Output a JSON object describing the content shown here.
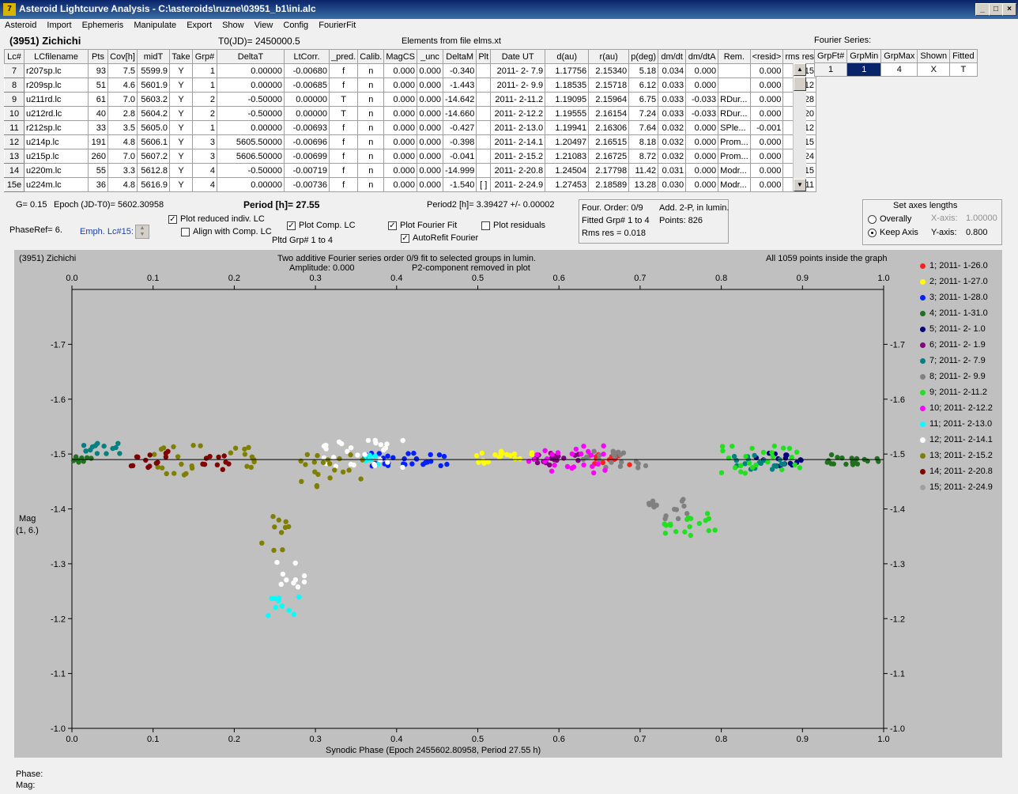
{
  "window": {
    "title": "Asteroid Lightcurve Analysis - C:\\asteroids\\ruzne\\03951_b1\\ini.alc",
    "icon": "7"
  },
  "menu": [
    "Asteroid",
    "Import",
    "Ephemeris",
    "Manipulate",
    "Export",
    "Show",
    "View",
    "Config",
    "FourierFit"
  ],
  "header": {
    "object": "(3951) Zichichi",
    "t0": "T0(JD)= 2450000.5",
    "elements": "Elements from file elms.xt",
    "fourier_label": "Fourier Series:"
  },
  "grid": {
    "columns": [
      "Lc#",
      "LCfilename",
      "Pts",
      "Cov[h]",
      "midT",
      "Take",
      "Grp#",
      "DeltaT",
      "LtCorr.",
      "_pred.",
      "Calib.",
      "MagCS",
      "_unc",
      "DeltaM",
      "Plt",
      "Date UT",
      "d(au)",
      "r(au)",
      "p(deg)",
      "dm/dt",
      "dm/dtA",
      "Rem.",
      "<resid>",
      "rms res"
    ],
    "rows": [
      [
        "7",
        "r207sp.lc",
        "93",
        "7.5",
        "5599.9",
        "Y",
        "1",
        "0.00000",
        "-0.00680",
        "f",
        "n",
        "0.000",
        "0.000",
        "-0.340",
        "",
        "2011- 2- 7.9",
        "1.17756",
        "2.15340",
        "5.18",
        "0.034",
        "0.000",
        "",
        "0.000",
        "0.015"
      ],
      [
        "8",
        "r209sp.lc",
        "51",
        "4.6",
        "5601.9",
        "Y",
        "1",
        "0.00000",
        "-0.00685",
        "f",
        "n",
        "0.000",
        "0.000",
        "-1.443",
        "",
        "2011- 2- 9.9",
        "1.18535",
        "2.15718",
        "6.12",
        "0.033",
        "0.000",
        "",
        "0.000",
        "0.012"
      ],
      [
        "9",
        "u211rd.lc",
        "61",
        "7.0",
        "5603.2",
        "Y",
        "2",
        "-0.50000",
        "0.00000",
        "T",
        "n",
        "0.000",
        "0.000",
        "-14.642",
        "",
        "2011- 2-11.2",
        "1.19095",
        "2.15964",
        "6.75",
        "0.033",
        "-0.033",
        "RDur...",
        "0.000",
        "0.028"
      ],
      [
        "10",
        "u212rd.lc",
        "40",
        "2.8",
        "5604.2",
        "Y",
        "2",
        "-0.50000",
        "0.00000",
        "T",
        "n",
        "0.000",
        "0.000",
        "-14.660",
        "",
        "2011- 2-12.2",
        "1.19555",
        "2.16154",
        "7.24",
        "0.033",
        "-0.033",
        "RDur...",
        "0.000",
        "0.020"
      ],
      [
        "11",
        "r212sp.lc",
        "33",
        "3.5",
        "5605.0",
        "Y",
        "1",
        "0.00000",
        "-0.00693",
        "f",
        "n",
        "0.000",
        "0.000",
        "-0.427",
        "",
        "2011- 2-13.0",
        "1.19941",
        "2.16306",
        "7.64",
        "0.032",
        "0.000",
        "SPle...",
        "-0.001",
        "0.012"
      ],
      [
        "12",
        "u214p.lc",
        "191",
        "4.8",
        "5606.1",
        "Y",
        "3",
        "5605.50000",
        "-0.00696",
        "f",
        "n",
        "0.000",
        "0.000",
        "-0.398",
        "",
        "2011- 2-14.1",
        "1.20497",
        "2.16515",
        "8.18",
        "0.032",
        "0.000",
        "Prom...",
        "0.000",
        "0.015"
      ],
      [
        "13",
        "u215p.lc",
        "260",
        "7.0",
        "5607.2",
        "Y",
        "3",
        "5606.50000",
        "-0.00699",
        "f",
        "n",
        "0.000",
        "0.000",
        "-0.041",
        "",
        "2011- 2-15.2",
        "1.21083",
        "2.16725",
        "8.72",
        "0.032",
        "0.000",
        "Prom...",
        "0.000",
        "0.024"
      ],
      [
        "14",
        "u220m.lc",
        "55",
        "3.3",
        "5612.8",
        "Y",
        "4",
        "-0.50000",
        "-0.00719",
        "f",
        "n",
        "0.000",
        "0.000",
        "-14.999",
        "",
        "2011- 2-20.8",
        "1.24504",
        "2.17798",
        "11.42",
        "0.031",
        "0.000",
        "Modr...",
        "0.000",
        "0.015"
      ],
      [
        "15e",
        "u224m.lc",
        "36",
        "4.8",
        "5616.9",
        "Y",
        "4",
        "0.00000",
        "-0.00736",
        "f",
        "n",
        "0.000",
        "0.000",
        "-1.540",
        "[ ]",
        "2011- 2-24.9",
        "1.27453",
        "2.18589",
        "13.28",
        "0.030",
        "0.000",
        "Modr...",
        "0.000",
        "0.011"
      ]
    ]
  },
  "fourier_table": {
    "columns": [
      "GrpFt#",
      "GrpMin",
      "GrpMax",
      "Shown",
      "Fitted"
    ],
    "row": [
      "1",
      "1",
      "4",
      "X",
      "T"
    ]
  },
  "info": {
    "g": "G= 0.15",
    "epoch": "Epoch (JD-T0)= 5602.30958",
    "period": "Period [h]= 27.55",
    "period2": "Period2 [h]= 3.39427 +/- 0.00002",
    "phaseref": "PhaseRef= 6.",
    "emph": "Emph. Lc#15:",
    "cb_reduced": "Plot reduced indiv. LC",
    "cb_align": "Align with Comp. LC",
    "cb_comp": "Plot Comp. LC",
    "pltd_grp": "Pltd Grp#  1    to    4",
    "cb_fourier": "Plot Fourier Fit",
    "cb_autorefit": "AutoRefit Fourier",
    "cb_residuals": "Plot residuals",
    "four_order": "Four. Order:  0/9",
    "add2p": "Add. 2-P, in lumin.",
    "fitted_grp": "Fitted Grp# 1 to 4",
    "points": "Points: 826",
    "rms": "Rms res     = 0.018"
  },
  "axes_box": {
    "title": "Set axes lengths",
    "overally": "Overally",
    "keep": "Keep Axis",
    "xaxis_label": "X-axis:",
    "xaxis_val": "1.00000",
    "yaxis_label": "Y-axis:",
    "yaxis_val": "0.800"
  },
  "plot": {
    "name": "(3951) Zichichi",
    "title1": "Two additive Fourier series order 0/9 fit to selected groups in lumin.",
    "title2a": "Amplitude: 0.000",
    "title2b": "P2-component removed in plot",
    "inside": "All 1059 points inside the graph",
    "ylabel1": "Mag",
    "ylabel2": "(1, 6.)",
    "xlabel": "Synodic Phase (Epoch 2455602.80958, Period 27.55 h)"
  },
  "chart_data": {
    "type": "scatter",
    "xlim": [
      0.0,
      1.0
    ],
    "ylim": [
      -1.0,
      -1.8
    ],
    "xticks": [
      "0.0",
      "0.1",
      "0.2",
      "0.3",
      "0.4",
      "0.5",
      "0.6",
      "0.7",
      "0.8",
      "0.9",
      "1.0"
    ],
    "yticks": [
      "-1.7",
      "-1.6",
      "-1.5",
      "-1.4",
      "-1.3",
      "-1.2",
      "-1.1",
      "-1.0"
    ],
    "fit_line_y": -1.49,
    "series": [
      {
        "name": "1; 2011- 1-26.0",
        "color": "#ff2020",
        "segments": [
          [
            0.64,
            0.69,
            -1.49,
            0.01
          ]
        ]
      },
      {
        "name": "2; 2011- 1-27.0",
        "color": "#ffff00",
        "segments": [
          [
            0.495,
            0.57,
            -1.495,
            0.012
          ]
        ]
      },
      {
        "name": "3; 2011- 1-28.0",
        "color": "#0020ff",
        "segments": [
          [
            0.36,
            0.47,
            -1.49,
            0.012
          ]
        ]
      },
      {
        "name": "4; 2011- 1-31.0",
        "color": "#207020",
        "segments": [
          [
            0.0,
            0.03,
            -1.485,
            0.01
          ],
          [
            0.93,
            1.0,
            -1.49,
            0.01
          ]
        ]
      },
      {
        "name": "5; 2011- 2- 1.0",
        "color": "#000080",
        "segments": [
          [
            0.84,
            0.9,
            -1.49,
            0.012
          ]
        ]
      },
      {
        "name": "6; 2011- 2- 1.9",
        "color": "#800080",
        "segments": [
          [
            0.57,
            0.63,
            -1.49,
            0.012
          ]
        ]
      },
      {
        "name": "7; 2011- 2- 7.9",
        "color": "#008080",
        "segments": [
          [
            0.01,
            0.065,
            -1.51,
            0.01
          ],
          [
            0.81,
            0.88,
            -1.485,
            0.015
          ]
        ]
      },
      {
        "name": "8; 2011- 2- 9.9",
        "color": "#808080",
        "segments": [
          [
            0.63,
            0.71,
            -1.49,
            0.015
          ],
          [
            0.71,
            0.78,
            -1.4,
            0.02
          ]
        ]
      },
      {
        "name": "9; 2011- 2-11.2",
        "color": "#20e020",
        "segments": [
          [
            0.73,
            0.8,
            -1.37,
            0.025
          ],
          [
            0.8,
            0.9,
            -1.49,
            0.025
          ]
        ]
      },
      {
        "name": "10; 2011- 2-12.2",
        "color": "#ff00ff",
        "segments": [
          [
            0.56,
            0.66,
            -1.49,
            0.025
          ]
        ]
      },
      {
        "name": "11; 2011- 2-13.0",
        "color": "#00ffff",
        "segments": [
          [
            0.24,
            0.28,
            -1.22,
            0.025
          ],
          [
            0.36,
            0.38,
            -1.49,
            0.01
          ]
        ]
      },
      {
        "name": "12; 2011- 2-14.1",
        "color": "#ffffff",
        "segments": [
          [
            0.25,
            0.29,
            -1.28,
            0.03
          ],
          [
            0.3,
            0.41,
            -1.5,
            0.025
          ]
        ]
      },
      {
        "name": "13; 2011- 2-15.2",
        "color": "#808000",
        "segments": [
          [
            0.1,
            0.16,
            -1.49,
            0.03
          ],
          [
            0.19,
            0.23,
            -1.49,
            0.03
          ],
          [
            0.23,
            0.27,
            -1.36,
            0.04
          ],
          [
            0.28,
            0.36,
            -1.47,
            0.03
          ]
        ]
      },
      {
        "name": "14; 2011- 2-20.8",
        "color": "#800000",
        "segments": [
          [
            0.07,
            0.12,
            -1.49,
            0.015
          ],
          [
            0.16,
            0.2,
            -1.485,
            0.015
          ]
        ]
      },
      {
        "name": "15; 2011- 2-24.9",
        "color": "#a0a0a0",
        "segments": []
      }
    ]
  },
  "status": {
    "phase": "Phase:",
    "mag": "Mag:"
  }
}
